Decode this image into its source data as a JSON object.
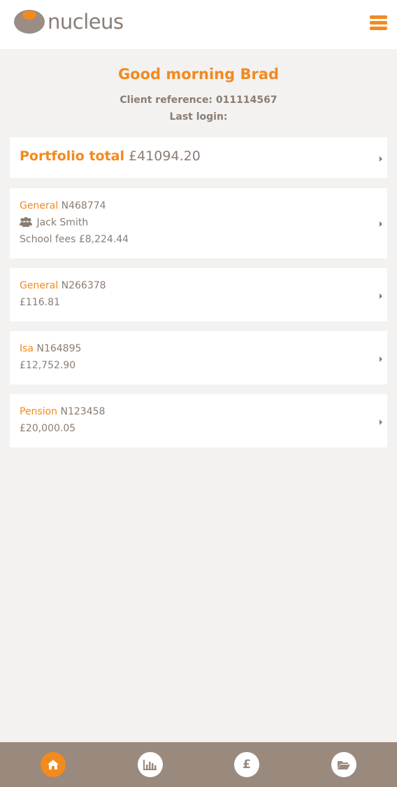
{
  "header": {
    "logo_text": "nucleus",
    "menu_icon": "hamburger-menu-icon"
  },
  "welcome": {
    "greeting": "Good morning Brad",
    "client_reference": "Client reference: 011114567",
    "last_login": "Last login:"
  },
  "portfolio": {
    "label": "Portfolio total",
    "total": "£41094.20"
  },
  "accounts": [
    {
      "type": "General",
      "number": "N468774",
      "holder": "Jack Smith",
      "detail": "School fees £8,224.44"
    },
    {
      "type": "General",
      "number": "N266378",
      "detail": "£116.81"
    },
    {
      "type": "Isa",
      "number": "N164895",
      "detail": "£12,752.90"
    },
    {
      "type": "Pension",
      "number": "N123458",
      "detail": "£20,000.05"
    }
  ],
  "bottom_nav": {
    "items": [
      {
        "icon": "home-icon",
        "active": true
      },
      {
        "icon": "bar-chart-icon",
        "active": false
      },
      {
        "icon": "pound-icon",
        "glyph": "£",
        "active": false
      },
      {
        "icon": "folder-open-icon",
        "active": false
      }
    ]
  },
  "colors": {
    "accent": "#f28a1e",
    "text": "#8a7d74",
    "background": "#f3f2f0",
    "nav_bar": "#9a8a7e"
  }
}
